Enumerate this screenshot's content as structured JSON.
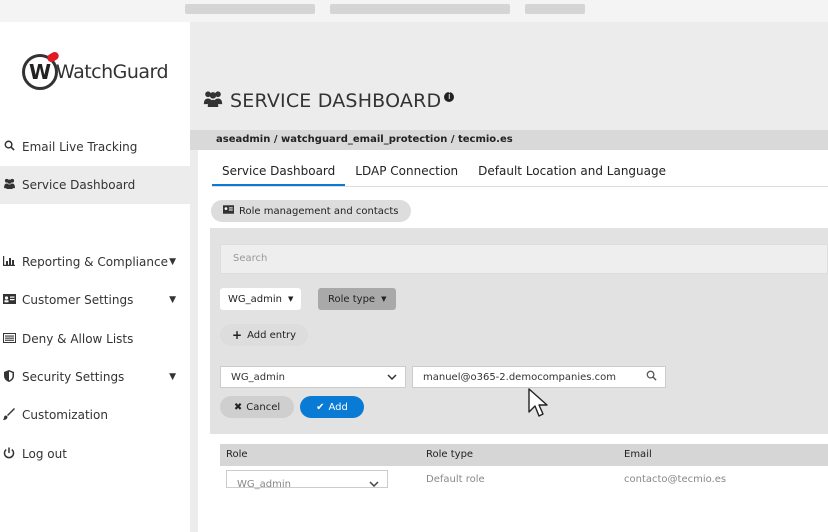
{
  "brand": {
    "logo_text": "WatchGuard"
  },
  "sidebar": {
    "items": [
      {
        "label": "Email Live Tracking",
        "icon": "search-icon"
      },
      {
        "label": "Service Dashboard",
        "icon": "users-icon",
        "active": true
      },
      {
        "label": "Reporting & Compliance",
        "icon": "bar-chart-icon",
        "has_caret": true
      },
      {
        "label": "Customer Settings",
        "icon": "id-card-icon",
        "has_caret": true
      },
      {
        "label": "Deny & Allow Lists",
        "icon": "list-icon"
      },
      {
        "label": "Security Settings",
        "icon": "shield-icon",
        "has_caret": true
      },
      {
        "label": "Customization",
        "icon": "brush-icon"
      },
      {
        "label": "Log out",
        "icon": "power-icon"
      }
    ]
  },
  "page": {
    "title": "SERVICE DASHBOARD",
    "breadcrumb": "aseadmin / watchguard_email_protection / tecmio.es",
    "tabs": [
      "Service Dashboard",
      "LDAP Connection",
      "Default Location and Language"
    ],
    "active_tab": 0,
    "role_mgmt_label": "Role management and contacts"
  },
  "filters": {
    "search_placeholder": "Search",
    "role_filter": "WG_admin",
    "role_type_filter": "Role type",
    "add_entry_label": "Add entry"
  },
  "form": {
    "role_value": "WG_admin",
    "email_value": "manuel@o365-2.democompanies.com",
    "cancel_label": "Cancel",
    "add_label": "Add"
  },
  "table": {
    "headers": [
      "Role",
      "Role type",
      "Email"
    ],
    "rows": [
      {
        "role": "WG_admin",
        "role_type": "Default role",
        "email": "contacto@tecmio.es"
      }
    ]
  },
  "colors": {
    "accent": "#0a7bd4",
    "brand_red": "#e01b22"
  }
}
